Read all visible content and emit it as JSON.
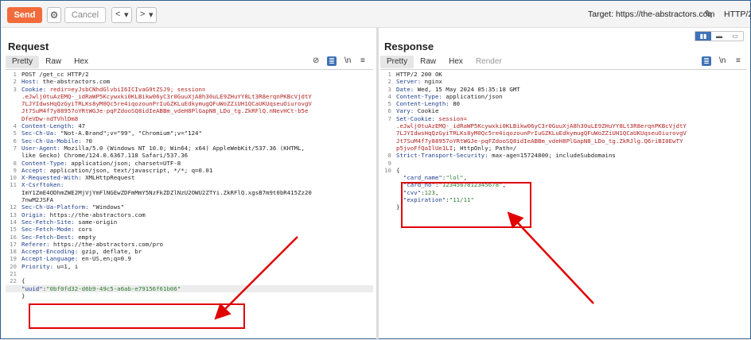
{
  "toolbar": {
    "send_label": "Send",
    "cancel_label": "Cancel",
    "target_label": "Target: https://the-abstractors.com",
    "protocol_label": "HTTP/2",
    "layout_options": [
      "▮▮",
      "▬",
      "▭"
    ]
  },
  "request": {
    "title": "Request",
    "tabs": [
      "Pretty",
      "Raw",
      "Hex"
    ],
    "lines": [
      {
        "n": "1",
        "parts": [
          [
            "",
            "POST /get_cc HTTP/2"
          ]
        ]
      },
      {
        "n": "2",
        "parts": [
          [
            "h",
            "Host:"
          ],
          [
            "",
            " the-abstractors.com"
          ]
        ]
      },
      {
        "n": "3",
        "parts": [
          [
            "h",
            "Cookie:"
          ],
          [
            "r",
            " redir=eyJsbCNhdGlvbiI6ICIvaG9tZSJ9; session="
          ]
        ]
      },
      {
        "n": "",
        "parts": [
          [
            "r",
            ".eJwlj0tuAzEMQ-_idRaWP5Kcywxki0KLBikw06yC3r0GuuXjA8h30uLE9ZHuYY8Lt3R8erqnPKBcVjdtY"
          ]
        ]
      },
      {
        "n": "",
        "parts": [
          [
            "r",
            "7LJYIdwsHqQzGyiTRLKs8yM0Qc5re4iqozounPrIuGZKLuEdkymugQFuWoZZiUH1QCaUKUqseuOiurovgV"
          ]
        ]
      },
      {
        "n": "",
        "parts": [
          [
            "r",
            "Jt7SuM4f7y88957oYRtWGJe-pqFZdooSQ8idIeABBm_vdeH8PlGapN8_LDo_tg.ZkRFlQ.nNevHCt-b5e"
          ]
        ]
      },
      {
        "n": "",
        "parts": [
          [
            "r",
            "DfeVDw-ndTVhlDm8"
          ]
        ]
      },
      {
        "n": "4",
        "parts": [
          [
            "h",
            "Content-Length:"
          ],
          [
            "",
            " 47"
          ]
        ]
      },
      {
        "n": "5",
        "parts": [
          [
            "h",
            "Sec-Ch-Ua:"
          ],
          [
            "",
            " \"Not-A.Brand\";v=\"99\", \"Chromium\";v=\"124\""
          ]
        ]
      },
      {
        "n": "6",
        "parts": [
          [
            "h",
            "Sec-Ch-Ua-Mobile:"
          ],
          [
            "",
            " ?0"
          ]
        ]
      },
      {
        "n": "7",
        "parts": [
          [
            "h",
            "User-Agent:"
          ],
          [
            "",
            " Mozilla/5.0 (Windows NT 10.0; Win64; x64) AppleWebKit/537.36 (KHTML,"
          ]
        ]
      },
      {
        "n": "",
        "parts": [
          [
            "",
            "like Gecko) Chrome/124.0.6367.118 Safari/537.36"
          ]
        ]
      },
      {
        "n": "8",
        "parts": [
          [
            "h",
            "Content-Type:"
          ],
          [
            "",
            " application/json; charset=UTF-8"
          ]
        ]
      },
      {
        "n": "9",
        "parts": [
          [
            "h",
            "Accept:"
          ],
          [
            "",
            " application/json, text/javascript, */*; q=0.01"
          ]
        ]
      },
      {
        "n": "10",
        "parts": [
          [
            "h",
            "X-Requested-With:"
          ],
          [
            "",
            " XMLHttpRequest"
          ]
        ]
      },
      {
        "n": "11",
        "parts": [
          [
            "h",
            "X-Csrftoken:"
          ]
        ]
      },
      {
        "n": "",
        "parts": [
          [
            "",
            "ImY1ZmE4ODhmZWE2MjVjYmFlNGEwZDFmMmY5NzFkZDZlNzU2OWU2ZTYi.ZkRFlQ.xgsB7m9t0bR415Zz20"
          ]
        ]
      },
      {
        "n": "",
        "parts": [
          [
            "",
            "7nwM2JSFA"
          ]
        ]
      },
      {
        "n": "12",
        "parts": [
          [
            "h",
            "Sec-Ch-Ua-Platform:"
          ],
          [
            "",
            " \"Windows\""
          ]
        ]
      },
      {
        "n": "13",
        "parts": [
          [
            "h",
            "Origin:"
          ],
          [
            "",
            " https://the-abstractors.com"
          ]
        ]
      },
      {
        "n": "14",
        "parts": [
          [
            "h",
            "Sec-Fetch-Site:"
          ],
          [
            "",
            " same-origin"
          ]
        ]
      },
      {
        "n": "15",
        "parts": [
          [
            "h",
            "Sec-Fetch-Mode:"
          ],
          [
            "",
            " cors"
          ]
        ]
      },
      {
        "n": "16",
        "parts": [
          [
            "h",
            "Sec-Fetch-Dest:"
          ],
          [
            "",
            " empty"
          ]
        ]
      },
      {
        "n": "17",
        "parts": [
          [
            "h",
            "Referer:"
          ],
          [
            "",
            " https://the-abstractors.com/pro"
          ]
        ]
      },
      {
        "n": "18",
        "parts": [
          [
            "h",
            "Accept-Encoding:"
          ],
          [
            "",
            " gzip, deflate, br"
          ]
        ]
      },
      {
        "n": "19",
        "parts": [
          [
            "h",
            "Accept-Language:"
          ],
          [
            "",
            " en-US,en;q=0.9"
          ]
        ]
      },
      {
        "n": "20",
        "parts": [
          [
            "h",
            "Priority:"
          ],
          [
            "",
            " u=1, i"
          ]
        ]
      },
      {
        "n": "21",
        "parts": [
          [
            "",
            ""
          ]
        ]
      },
      {
        "n": "22",
        "parts": [
          [
            "",
            "{"
          ]
        ]
      },
      {
        "n": "",
        "hl": true,
        "parts": [
          [
            "k",
            "\"uuid\""
          ],
          [
            "",
            ":"
          ],
          [
            "v",
            "\"0bf0fd32-d6b9-49c5-a6ab-e79156f61b06\""
          ]
        ]
      },
      {
        "n": "",
        "parts": [
          [
            "",
            "}"
          ]
        ]
      }
    ]
  },
  "response": {
    "title": "Response",
    "tabs": [
      "Pretty",
      "Raw",
      "Hex",
      "Render"
    ],
    "lines": [
      {
        "n": "1",
        "parts": [
          [
            "",
            "HTTP/2 200 OK"
          ]
        ]
      },
      {
        "n": "2",
        "parts": [
          [
            "h",
            "Server:"
          ],
          [
            "",
            " nginx"
          ]
        ]
      },
      {
        "n": "3",
        "parts": [
          [
            "h",
            "Date:"
          ],
          [
            "",
            " Wed, 15 May 2024 05:35:18 GMT"
          ]
        ]
      },
      {
        "n": "4",
        "parts": [
          [
            "h",
            "Content-Type:"
          ],
          [
            "",
            " application/json"
          ]
        ]
      },
      {
        "n": "5",
        "parts": [
          [
            "h",
            "Content-Length:"
          ],
          [
            "",
            " 80"
          ]
        ]
      },
      {
        "n": "6",
        "parts": [
          [
            "h",
            "Vary:"
          ],
          [
            "",
            " Cookie"
          ]
        ]
      },
      {
        "n": "7",
        "parts": [
          [
            "h",
            "Set-Cookie:"
          ],
          [
            "r",
            " session="
          ]
        ]
      },
      {
        "n": "",
        "parts": [
          [
            "r",
            ".eJwlj0tuAzEMQ-_idRaWP5Kcywxki0KLBikw06yC3r0GuuXjA8h30uLE9ZHuYY8Lt3R8erqnPKBcVjdtY"
          ]
        ]
      },
      {
        "n": "",
        "parts": [
          [
            "r",
            "7LJYIdwsHqQzGyiTRLKs8yM0Qc5re4iqozounPrIuGZKLuEdkymugQFuWoZZiUH1QCaUKUqseuOiurovgV"
          ]
        ]
      },
      {
        "n": "",
        "parts": [
          [
            "r",
            "Jt7SuM4f7y88957oYRtWGJe-pqFZdooSQ8idIeABBm_vdeH8PlGapN8_LDo_tg.ZkRJlg.Q6riBI0EwTY"
          ]
        ]
      },
      {
        "n": "",
        "parts": [
          [
            "r",
            "p5jvoFfQaIlUe1LI"
          ],
          [
            "",
            "; HttpOnly; Path=/"
          ]
        ]
      },
      {
        "n": "8",
        "parts": [
          [
            "h",
            "Strict-Transport-Security:"
          ],
          [
            "",
            " max-age=15724800; includeSubdomains"
          ]
        ]
      },
      {
        "n": "9",
        "parts": [
          [
            "",
            ""
          ]
        ]
      },
      {
        "n": "10",
        "parts": [
          [
            "",
            "{"
          ]
        ]
      },
      {
        "n": "",
        "parts": [
          [
            "",
            "  "
          ],
          [
            "k",
            "\"card_name\""
          ],
          [
            "",
            ":"
          ],
          [
            "v",
            "\"lol\""
          ],
          [
            "",
            ","
          ]
        ]
      },
      {
        "n": "",
        "parts": [
          [
            "",
            "  "
          ],
          [
            "k",
            "\"card_no\""
          ],
          [
            "",
            ":"
          ],
          [
            "v",
            "\"1234567812345678\""
          ],
          [
            "",
            ","
          ]
        ]
      },
      {
        "n": "",
        "parts": [
          [
            "",
            "  "
          ],
          [
            "k",
            "\"cvv\""
          ],
          [
            "",
            ":"
          ],
          [
            "v",
            "123"
          ],
          [
            "",
            ","
          ]
        ]
      },
      {
        "n": "",
        "parts": [
          [
            "",
            "  "
          ],
          [
            "k",
            "\"expiration\""
          ],
          [
            "",
            ":"
          ],
          [
            "v",
            "\"11/11\""
          ]
        ]
      },
      {
        "n": "",
        "parts": [
          [
            "",
            "}"
          ]
        ]
      }
    ]
  },
  "colors": {
    "accent": "#f26b3a",
    "header_name": "#1d3e8c",
    "cookie_value": "#b12424",
    "json_string": "#2e7d32",
    "annotation": "#e00000"
  }
}
